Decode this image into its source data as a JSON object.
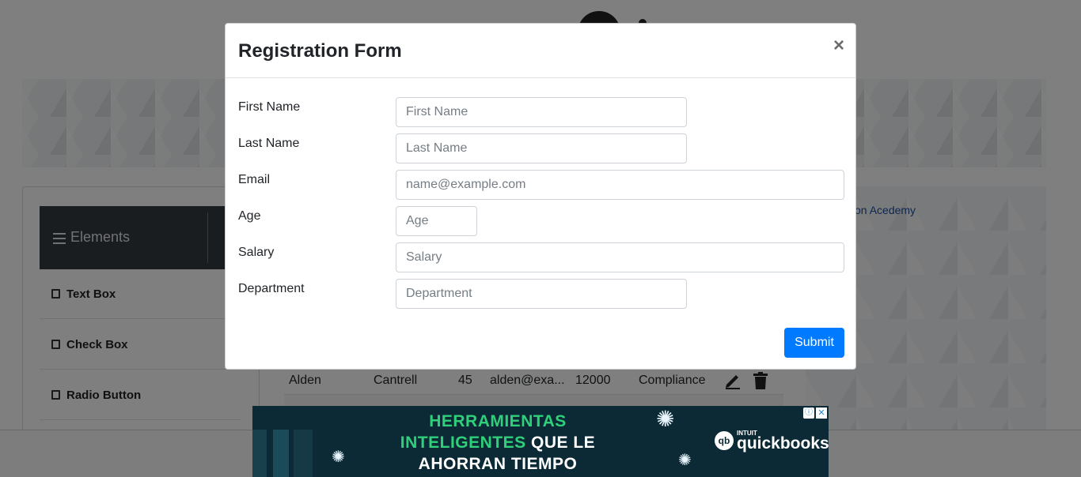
{
  "background": {
    "sidebar": {
      "header_label": "Elements",
      "items": [
        {
          "label": "Text Box"
        },
        {
          "label": "Check Box"
        },
        {
          "label": "Radio Button"
        }
      ]
    },
    "right_link": "on Acedemy",
    "table_row": {
      "first_name": "Alden",
      "last_name": "Cantrell",
      "age": "45",
      "email": "alden@exa...",
      "salary": "12000",
      "department": "Compliance",
      "edit_icon": "pencil-icon",
      "delete_icon": "trash-icon"
    }
  },
  "modal": {
    "title": "Registration Form",
    "close_label": "×",
    "fields": {
      "first_name": {
        "label": "First Name",
        "placeholder": "First Name",
        "value": ""
      },
      "last_name": {
        "label": "Last Name",
        "placeholder": "Last Name",
        "value": ""
      },
      "email": {
        "label": "Email",
        "placeholder": "name@example.com",
        "value": ""
      },
      "age": {
        "label": "Age",
        "placeholder": "Age",
        "value": ""
      },
      "salary": {
        "label": "Salary",
        "placeholder": "Salary",
        "value": ""
      },
      "department": {
        "label": "Department",
        "placeholder": "Department",
        "value": ""
      }
    },
    "submit_label": "Submit"
  },
  "ad": {
    "line1": "HERRAMIENTAS",
    "line2_green": "INTELIGENTES",
    "line2_white": "QUE LE",
    "line3": "AHORRAN TIEMPO",
    "brand_small": "INTUIT",
    "brand_name": "quickbooks",
    "brand_mark": "qb",
    "adchoices_icon": "ⓘ",
    "close_icon": "✕"
  },
  "colors": {
    "primary": "#007bff",
    "sidebar_header": "#343a40",
    "ad_background": "#0c2a35",
    "ad_green": "#2fd07a"
  }
}
